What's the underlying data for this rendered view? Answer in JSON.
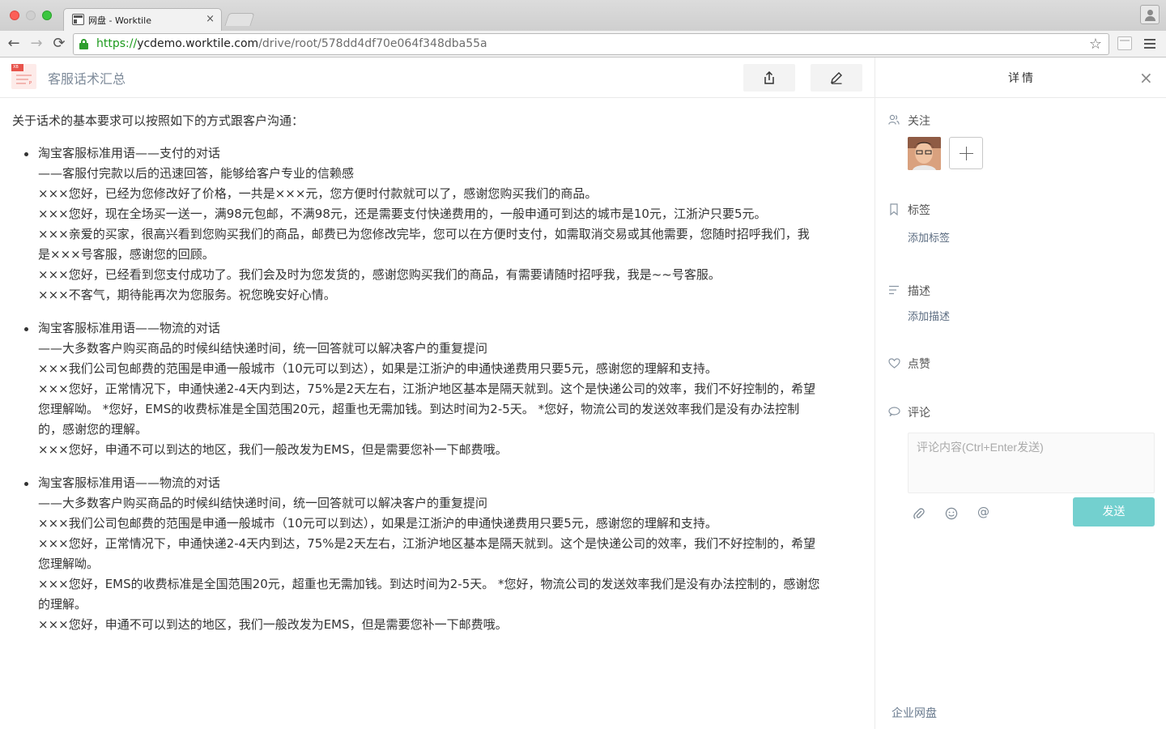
{
  "browser": {
    "tab_title": "网盘 - Worktile",
    "tab_close": "×",
    "url_protocol": "https://",
    "url_host": "ycdemo.worktile.com",
    "url_path": "/drive/root/578dd4df70e064f348dba55a",
    "back_icon": "←",
    "forward_icon": "→",
    "reload_icon": "⟳",
    "star_icon": "☆"
  },
  "doc": {
    "title": "客服话术汇总",
    "file_icon_label": "XB",
    "file_icon_sublabel": "P",
    "intro": "关于话术的基本要求可以按照如下的方式跟客户沟通：",
    "sections": [
      {
        "heading": "淘宝客服标准用语——支付的对话",
        "lines": [
          "——客服付完款以后的迅速回答，能够给客户专业的信赖感",
          "×××您好，已经为您修改好了价格，一共是×××元，您方便时付款就可以了，感谢您购买我们的商品。",
          "×××您好，现在全场买一送一，满98元包邮，不满98元，还是需要支付快递费用的，一般申通可到达的城市是10元，江浙沪只要5元。",
          "×××亲爱的买家，很高兴看到您购买我们的商品，邮费已为您修改完毕，您可以在方便时支付，如需取消交易或其他需要，您随时招呼我们，我",
          "是×××号客服，感谢您的回顾。",
          "×××您好，已经看到您支付成功了。我们会及时为您发货的，感谢您购买我们的商品，有需要请随时招呼我，我是~~号客服。",
          "×××不客气，期待能再次为您服务。祝您晚安好心情。"
        ]
      },
      {
        "heading": "淘宝客服标准用语——物流的对话",
        "lines": [
          "——大多数客户购买商品的时候纠结快递时间，统一回答就可以解决客户的重复提问",
          "×××我们公司包邮费的范围是申通一般城市（10元可以到达），如果是江浙沪的申通快递费用只要5元，感谢您的理解和支持。",
          "×××您好，正常情况下，申通快递2-4天内到达，75%是2天左右，江浙沪地区基本是隔天就到。这个是快递公司的效率，我们不好控制的，希望",
          "您理解呦。 *您好，EMS的收费标准是全国范围20元，超重也无需加钱。到达时间为2-5天。 *您好，物流公司的发送效率我们是没有办法控制",
          "的，感谢您的理解。",
          "×××您好，申通不可以到达的地区，我们一般改发为EMS，但是需要您补一下邮费哦。"
        ]
      },
      {
        "heading": "淘宝客服标准用语——物流的对话",
        "lines": [
          "——大多数客户购买商品的时候纠结快递时间，统一回答就可以解决客户的重复提问",
          "×××我们公司包邮费的范围是申通一般城市（10元可以到达），如果是江浙沪的申通快递费用只要5元，感谢您的理解和支持。",
          "×××您好，正常情况下，申通快递2-4天内到达，75%是2天左右，江浙沪地区基本是隔天就到。这个是快递公司的效率，我们不好控制的，希望",
          "您理解呦。",
          "×××您好，EMS的收费标准是全国范围20元，超重也无需加钱。到达时间为2-5天。 *您好，物流公司的发送效率我们是没有办法控制的，感谢您",
          "的理解。",
          "×××您好，申通不可以到达的地区，我们一般改发为EMS，但是需要您补一下邮费哦。"
        ]
      }
    ]
  },
  "panel": {
    "title": "详情",
    "close": "×",
    "follow_label": "关注",
    "tags_label": "标签",
    "add_tag": "添加标签",
    "desc_label": "描述",
    "add_desc": "添加描述",
    "like_label": "点赞",
    "comment_label": "评论",
    "comment_placeholder": "评论内容(Ctrl+Enter发送)",
    "send_label": "发送",
    "mention_icon": "@",
    "footer": "企业网盘"
  },
  "colors": {
    "accent": "#73d0cf",
    "link": "#5a6b80",
    "title_gray": "#7d8a99",
    "url_green": "#1c9a1c"
  },
  "icons": [
    "share-icon",
    "edit-icon",
    "users-icon",
    "bookmark-icon",
    "list-icon",
    "heart-icon",
    "comment-icon",
    "attachment-icon",
    "emoji-icon",
    "at-icon"
  ]
}
